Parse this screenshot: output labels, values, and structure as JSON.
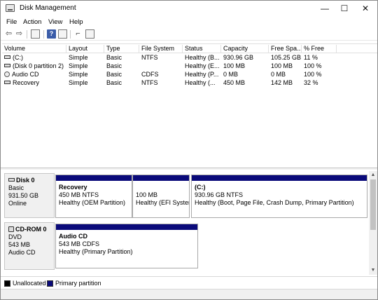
{
  "window": {
    "title": "Disk Management",
    "controls": {
      "minimize": "—",
      "maximize": "☐",
      "close": "✕"
    }
  },
  "menu": [
    "File",
    "Action",
    "View",
    "Help"
  ],
  "toolbar": {
    "buttons": [
      "back-icon",
      "forward-icon",
      "properties-icon",
      "help-icon",
      "console-tree-icon",
      "link-icon",
      "settings-icon"
    ]
  },
  "volume_table": {
    "columns": [
      "Volume",
      "Layout",
      "Type",
      "File System",
      "Status",
      "Capacity",
      "Free Spa...",
      "% Free"
    ],
    "rows": [
      {
        "volume": "(C:)",
        "layout": "Simple",
        "type": "Basic",
        "fs": "NTFS",
        "status": "Healthy (B...",
        "capacity": "930.96 GB",
        "free": "105.25 GB",
        "pct": "11 %",
        "icon": "drive"
      },
      {
        "volume": "(Disk 0 partition 2)",
        "layout": "Simple",
        "type": "Basic",
        "fs": "",
        "status": "Healthy (E...",
        "capacity": "100 MB",
        "free": "100 MB",
        "pct": "100 %",
        "icon": "drive"
      },
      {
        "volume": "Audio CD",
        "layout": "Simple",
        "type": "Basic",
        "fs": "CDFS",
        "status": "Healthy (P...",
        "capacity": "0 MB",
        "free": "0 MB",
        "pct": "100 %",
        "icon": "cd"
      },
      {
        "volume": "Recovery",
        "layout": "Simple",
        "type": "Basic",
        "fs": "NTFS",
        "status": "Healthy (...",
        "capacity": "450 MB",
        "free": "142 MB",
        "pct": "32 %",
        "icon": "drive"
      }
    ]
  },
  "disks": [
    {
      "name": "Disk 0",
      "type": "Basic",
      "size": "931.50 GB",
      "state": "Online",
      "partitions": [
        {
          "title": "Recovery",
          "line1": "450 MB NTFS",
          "line2": "Healthy (OEM Partition)"
        },
        {
          "title": "",
          "line1": "100 MB",
          "line2": "Healthy (EFI System"
        },
        {
          "title": "(C:)",
          "line1": "930.96 GB NTFS",
          "line2": "Healthy (Boot, Page File, Crash Dump, Primary Partition)"
        }
      ]
    },
    {
      "name": "CD-ROM 0",
      "type": "DVD",
      "size": "543 MB",
      "state": "Audio CD",
      "partitions": [
        {
          "title": "Audio CD",
          "line1": "543 MB CDFS",
          "line2": "Healthy (Primary Partition)"
        }
      ]
    }
  ],
  "legend": [
    {
      "label": "Unallocated",
      "color": "#000000"
    },
    {
      "label": "Primary partition",
      "color": "#0a0a7a"
    }
  ]
}
